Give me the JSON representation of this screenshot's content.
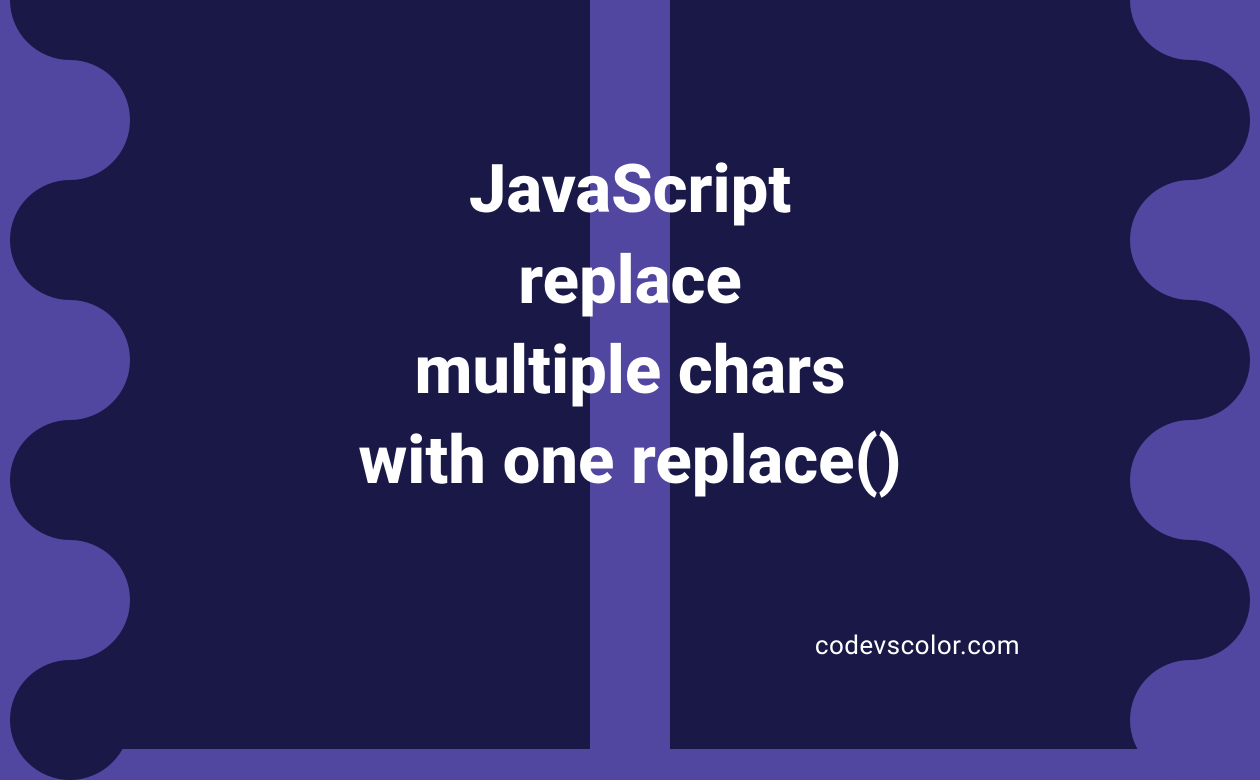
{
  "title_lines": {
    "l1": "JavaScript",
    "l2": "replace",
    "l3": "multiple chars",
    "l4": "with one replace()"
  },
  "watermark": "codevscolor.com",
  "colors": {
    "background": "#5146a0",
    "blob": "#191847",
    "text": "#ffffff"
  }
}
